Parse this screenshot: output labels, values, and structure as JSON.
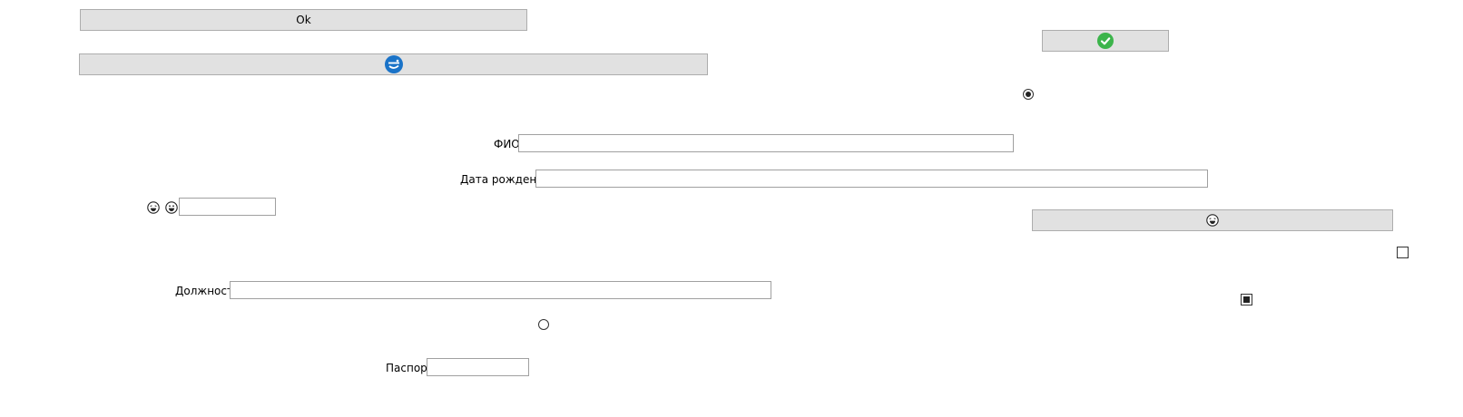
{
  "buttons": {
    "ok_label": "Ok"
  },
  "form": {
    "fio_label": "ФИО",
    "fio_value": "",
    "birthdate_label": "Дата рождения",
    "birthdate_value": "",
    "emoji_field_value": "",
    "position_label": "Должность",
    "position_value": "",
    "passport_label": "Паспорт",
    "passport_value": ""
  },
  "controls": {
    "radio_top_checked": true,
    "radio_bottom_checked": false,
    "checkbox_right_checked": false,
    "checkbox_lower_right_state": "indeterminate"
  },
  "icons": {
    "confirm_button": "check-circle-icon",
    "wide_button": "blue-circle-icon",
    "right_wide_button": "emoji-face-icon",
    "emoji_pair": [
      "laughing-face-icon",
      "grinning-face-icon"
    ]
  },
  "colors": {
    "button_bg": "#e1e1e1",
    "check_green": "#3cb44b",
    "icon_blue": "#1a73c8"
  }
}
